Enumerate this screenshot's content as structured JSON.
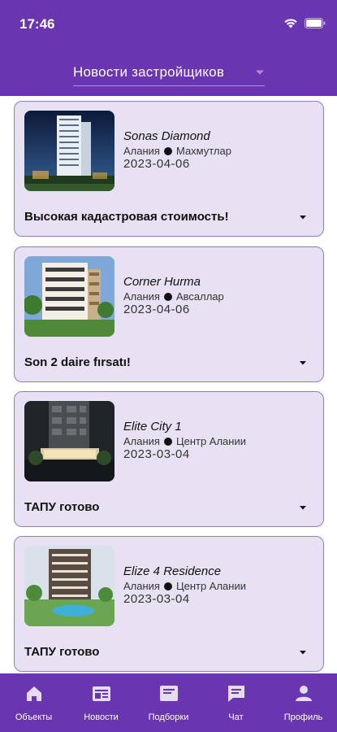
{
  "status": {
    "time": "17:46"
  },
  "header": {
    "dropdown_label": "Новости застройщиков"
  },
  "cards": [
    {
      "title": "Sonas Diamond",
      "city": "Алания",
      "district": "Махмутлар",
      "date": "2023-04-06",
      "headline": "Высокая кадастровая стоимость!"
    },
    {
      "title": "Corner Hurma",
      "city": "Алания",
      "district": "Авсаллар",
      "date": "2023-04-06",
      "headline": "Son 2 daire fırsatı!"
    },
    {
      "title": "Elite City 1",
      "city": "Алания",
      "district": "Центр Алании",
      "date": "2023-03-04",
      "headline": "ТАПУ готово"
    },
    {
      "title": "Elize 4 Residence",
      "city": "Алания",
      "district": "Центр Алании",
      "date": "2023-03-04",
      "headline": "ТАПУ готово"
    }
  ],
  "bottom_nav": [
    {
      "label": "Объекты",
      "icon": "home-icon"
    },
    {
      "label": "Новости",
      "icon": "news-icon"
    },
    {
      "label": "Подборки",
      "icon": "collections-icon"
    },
    {
      "label": "Чат",
      "icon": "chat-icon"
    },
    {
      "label": "Профиль",
      "icon": "profile-icon"
    }
  ],
  "colors": {
    "primary": "#6a35b0",
    "card_bg": "#e8e0f3",
    "card_border": "#8f7fc0"
  }
}
